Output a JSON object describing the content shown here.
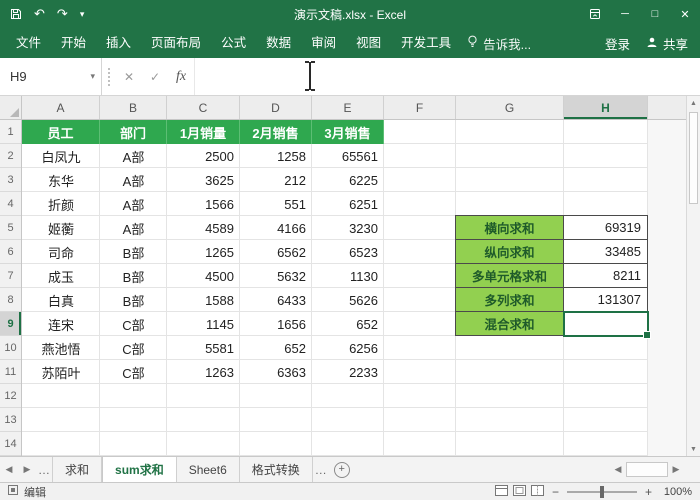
{
  "window": {
    "title": "演示文稿.xlsx - Excel",
    "minimize": "─",
    "maximize": "□",
    "close": "✕"
  },
  "ribbon": {
    "tabs": [
      "文件",
      "开始",
      "插入",
      "页面布局",
      "公式",
      "数据",
      "审阅",
      "视图",
      "开发工具"
    ],
    "tell_me": "告诉我...",
    "sign_in": "登录",
    "share": "共享"
  },
  "formula_bar": {
    "name_box": "H9",
    "fx_label": "fx",
    "formula_value": ""
  },
  "icons": {
    "undo": "↶",
    "redo": "↷",
    "qat_more": "▾",
    "namebox_dropdown": "▾",
    "cancel": "✕",
    "enter": "✓",
    "prev": "◀",
    "next": "▶",
    "up": "▲",
    "down": "▼",
    "overflow": "…",
    "add_sheet": "+",
    "zoom_out": "−",
    "zoom_in": "+"
  },
  "sheet": {
    "col_headers": [
      "A",
      "B",
      "C",
      "D",
      "E",
      "F",
      "G",
      "H"
    ],
    "row_headers": [
      "1",
      "2",
      "3",
      "4",
      "5",
      "6",
      "7",
      "8",
      "9",
      "10",
      "11",
      "12",
      "13",
      "14"
    ],
    "selected_cell": "H9",
    "table_headers": [
      "员工",
      "部门",
      "1月销量",
      "2月销售",
      "3月销售"
    ],
    "rows": [
      [
        "白凤九",
        "A部",
        "2500",
        "1258",
        "65561"
      ],
      [
        "东华",
        "A部",
        "3625",
        "212",
        "6225"
      ],
      [
        "折颜",
        "A部",
        "1566",
        "551",
        "6251"
      ],
      [
        "姬蘅",
        "A部",
        "4589",
        "4166",
        "3230"
      ],
      [
        "司命",
        "B部",
        "1265",
        "6562",
        "6523"
      ],
      [
        "成玉",
        "B部",
        "4500",
        "5632",
        "1130"
      ],
      [
        "白真",
        "B部",
        "1588",
        "6433",
        "5626"
      ],
      [
        "连宋",
        "C部",
        "1145",
        "1656",
        "652"
      ],
      [
        "燕池悟",
        "C部",
        "5581",
        "652",
        "6256"
      ],
      [
        "苏陌叶",
        "C部",
        "1263",
        "6363",
        "2233"
      ]
    ],
    "sum_labels": [
      "横向求和",
      "纵向求和",
      "多单元格求和",
      "多列求和",
      "混合求和"
    ],
    "sum_values": [
      "69319",
      "33485",
      "8211",
      "131307",
      ""
    ]
  },
  "sheet_tabs": {
    "tabs": [
      "求和",
      "sum求和",
      "Sheet6",
      "格式转换"
    ],
    "active_tab": "sum求和"
  },
  "status_bar": {
    "mode": "编辑",
    "zoom_level": "100%"
  },
  "colors": {
    "excel_green": "#217346",
    "table_header_fill": "#2FA84F",
    "sum_label_fill": "#92D050",
    "sum_label_text": "#1F5B2A",
    "selection_border": "#1E7145"
  }
}
